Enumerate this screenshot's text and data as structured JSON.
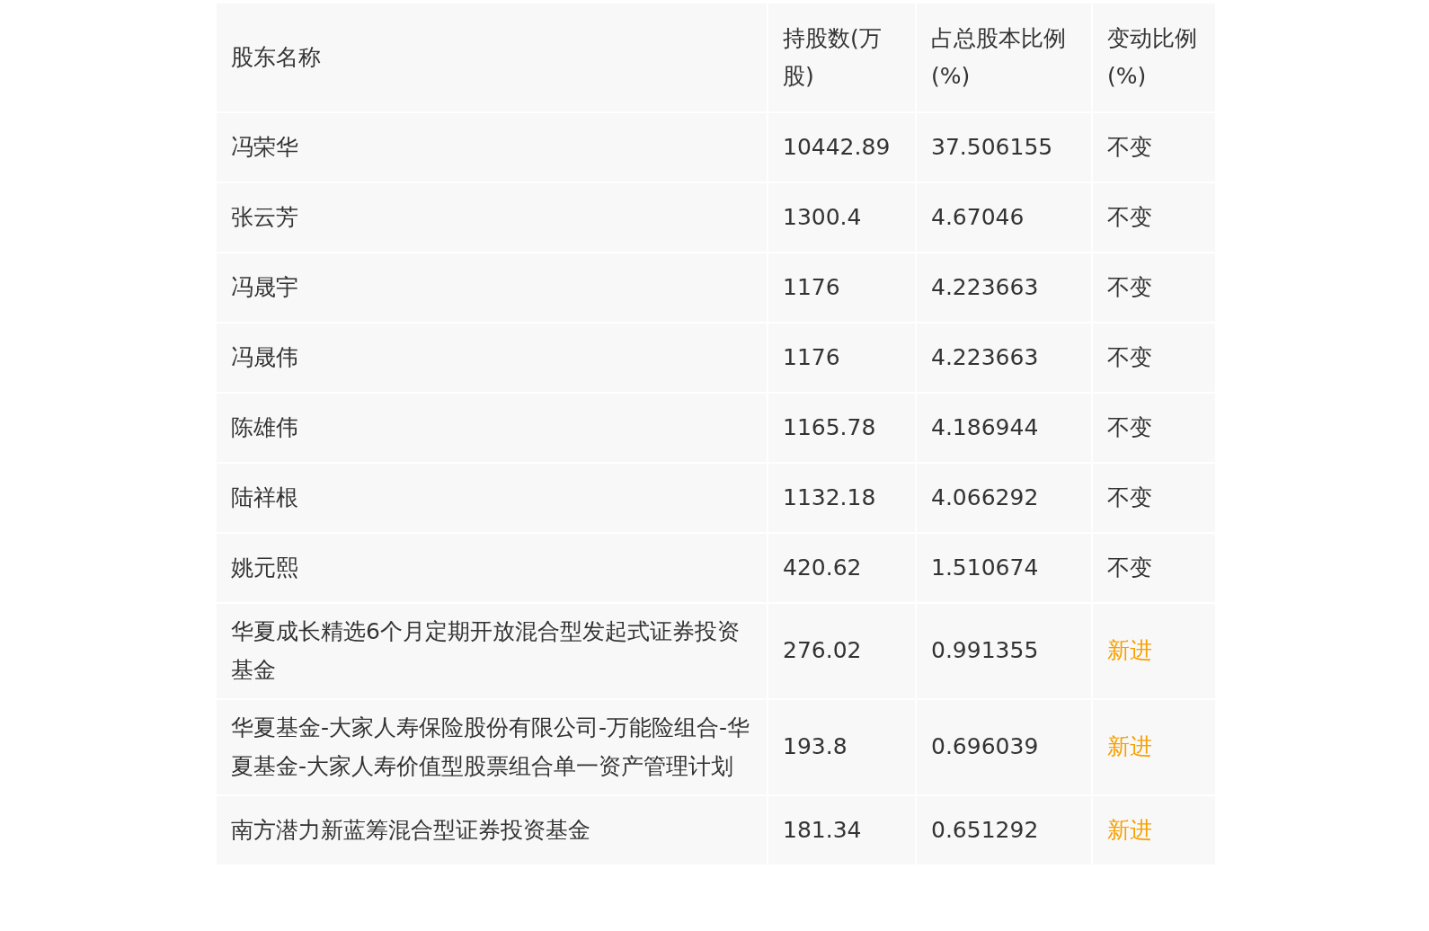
{
  "table": {
    "columns": [
      "股东名称",
      "持股数(万股)",
      "占总股本比例(%)",
      "变动比例(%)"
    ],
    "rows": [
      {
        "name": "冯荣华",
        "shares": "10442.89",
        "ratio": "37.506155",
        "change": "不变",
        "kind": "unchanged"
      },
      {
        "name": "张云芳",
        "shares": "1300.4",
        "ratio": "4.67046",
        "change": "不变",
        "kind": "unchanged"
      },
      {
        "name": "冯晟宇",
        "shares": "1176",
        "ratio": "4.223663",
        "change": "不变",
        "kind": "unchanged"
      },
      {
        "name": "冯晟伟",
        "shares": "1176",
        "ratio": "4.223663",
        "change": "不变",
        "kind": "unchanged"
      },
      {
        "name": "陈雄伟",
        "shares": "1165.78",
        "ratio": "4.186944",
        "change": "不变",
        "kind": "unchanged"
      },
      {
        "name": "陆祥根",
        "shares": "1132.18",
        "ratio": "4.066292",
        "change": "不变",
        "kind": "unchanged"
      },
      {
        "name": "姚元熙",
        "shares": "420.62",
        "ratio": "1.510674",
        "change": "不变",
        "kind": "unchanged"
      },
      {
        "name": "华夏成长精选6个月定期开放混合型发起式证券投资基金",
        "shares": "276.02",
        "ratio": "0.991355",
        "change": "新进",
        "kind": "new"
      },
      {
        "name": "华夏基金-大家人寿保险股份有限公司-万能险组合-华夏基金-大家人寿价值型股票组合单一资产管理计划",
        "shares": "193.8",
        "ratio": "0.696039",
        "change": "新进",
        "kind": "new"
      },
      {
        "name": "南方潜力新蓝筹混合型证券投资基金",
        "shares": "181.34",
        "ratio": "0.651292",
        "change": "新进",
        "kind": "new"
      }
    ]
  }
}
